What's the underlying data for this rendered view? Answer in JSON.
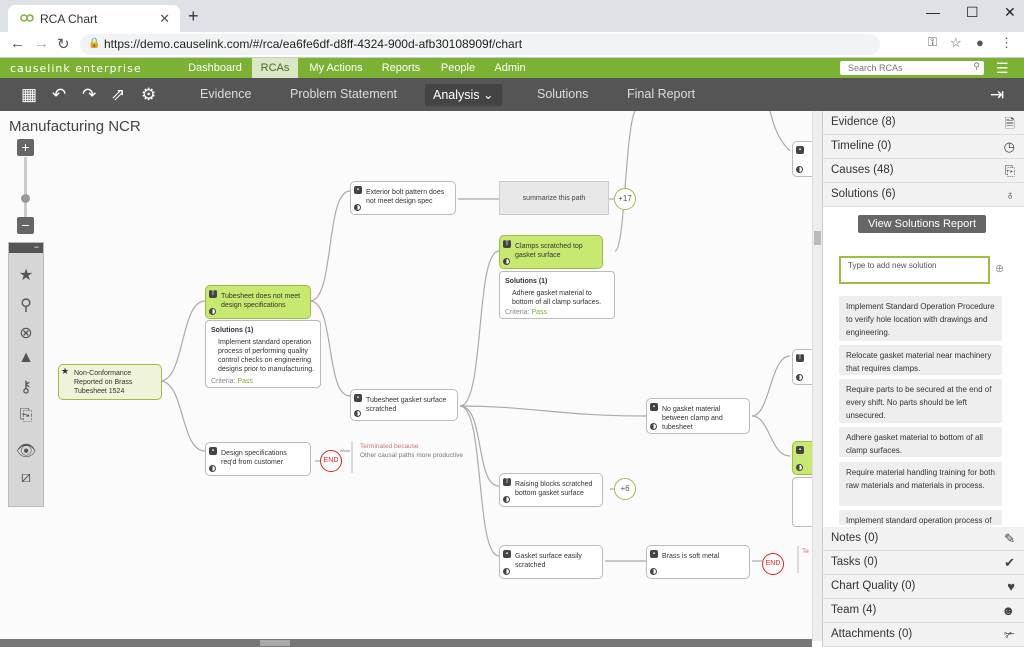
{
  "browser": {
    "tab_title": "RCA Chart",
    "url": "https://demo.causelink.com/#/rca/ea6fe6df-d8ff-4324-900d-afb30108909f/chart",
    "close": "✕",
    "new_tab": "+",
    "minimize": "—",
    "maximize": "☐",
    "close_window": "✕"
  },
  "app": {
    "brand": "causelink enterprise",
    "menu": [
      "Dashboard",
      "RCAs",
      "My Actions",
      "Reports",
      "People",
      "Admin"
    ],
    "search_placeholder": "Search RCAs"
  },
  "steps": [
    "Evidence",
    "Problem Statement",
    "Analysis",
    "Solutions",
    "Final Report"
  ],
  "chart_title": "Manufacturing NCR",
  "zoom": {
    "in": "+",
    "out": "−"
  },
  "nodes": {
    "root": "Non-Conformance Reported on Brass Tubesheet 1524",
    "tubesheet": "Tubesheet does not meet design specifications",
    "tubesheet_sol_header": "Solutions (1)",
    "tubesheet_sol": "Implement standard operation process of performing quality control checks on engineering designs prior to manufacturing.",
    "criteria_label": "Criteria:",
    "criteria_value": "Pass",
    "design_specs": "Design specifications req'd from customer",
    "end": "END",
    "terminated": "Terminated because",
    "terminated_reason": "Other causal paths more productive",
    "bolt": "Exterior bolt pattern does not meet design spec",
    "summarize": "summarize this path",
    "plus17": "+17",
    "scratched": "Tubesheet gasket surface scratched",
    "clamps": "Clamps scratched top gasket surface",
    "clamps_sol_header": "Solutions (1)",
    "clamps_sol": "Adhere gasket material to bottom of all clamp surfaces.",
    "no_gasket": "No gasket material between clamp and tubesheet",
    "raising": "Raising blocks scratched bottom gasket surface",
    "plus6": "+6",
    "easily": "Gasket surface easily scratched",
    "brass": "Brass is soft metal",
    "end2": "END",
    "terminated_cut": "Te"
  },
  "panel": {
    "sections_top": [
      {
        "label": "Evidence (8)",
        "icon": "📄"
      },
      {
        "label": "Timeline (0)",
        "icon": "🕘"
      },
      {
        "label": "Causes (48)",
        "icon": "⎘"
      },
      {
        "label": "Solutions (6)",
        "icon": "💡"
      }
    ],
    "view_report": "View Solutions Report",
    "new_solution_placeholder": "Type to add new solution",
    "solutions": [
      "Implement Standard Operation Procedure to verify hole location with drawings and engineering.",
      "Relocate gasket material near machinery that requires clamps.",
      "Require parts to be secured at the end of every shift. No parts should be left unsecured.",
      "Adhere gasket material to bottom of all clamp surfaces.",
      "Require material handling training for both raw materials and materials in process.",
      "Implement standard operation process of"
    ],
    "sections_bottom": [
      {
        "label": "Notes (0)",
        "icon": "✎"
      },
      {
        "label": "Tasks (0)",
        "icon": "✔"
      },
      {
        "label": "Chart Quality (0)",
        "icon": "👍"
      },
      {
        "label": "Team (4)",
        "icon": "👥"
      },
      {
        "label": "Attachments (0)",
        "icon": "📎"
      }
    ]
  },
  "colors": {
    "brand_green": "#7bb234",
    "node_green": "#c8e96f",
    "toolbar": "#555555",
    "end_red": "#dd2222"
  }
}
